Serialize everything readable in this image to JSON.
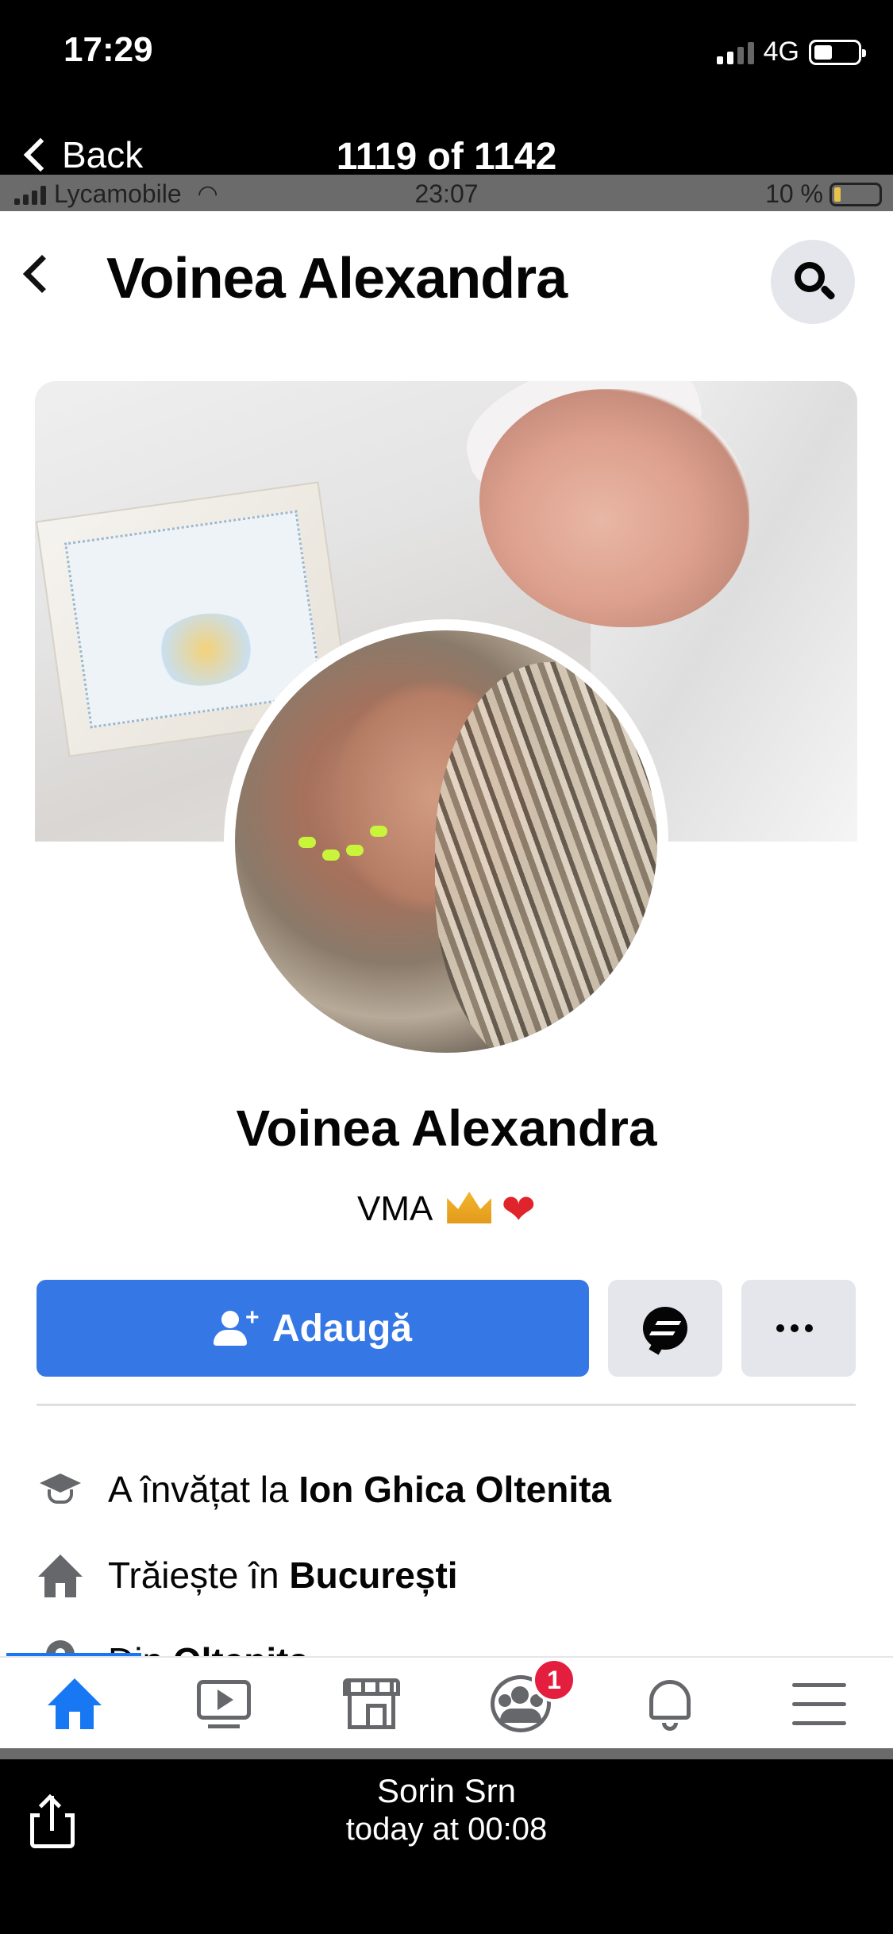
{
  "ios_status": {
    "time": "17:29",
    "network": "4G"
  },
  "viewer": {
    "back_label": "Back",
    "counter": "1119 of 1142"
  },
  "inner_status": {
    "carrier": "Lycamobile",
    "time": "23:07",
    "battery": "10 %"
  },
  "profile": {
    "header_title": "Voinea Alexandra",
    "name": "Voinea Alexandra",
    "bio": "VMA",
    "add_button_label": "Adaugă"
  },
  "info": {
    "education_prefix": "A învățat la",
    "education_value": "Ion Ghica Oltenita",
    "lives_prefix": "Trăiește în",
    "lives_value": "București",
    "from_prefix": "Din",
    "from_value": "Oltenița"
  },
  "tabbar": {
    "groups_badge": "1",
    "active": "home"
  },
  "message_footer": {
    "sender": "Sorin Srn",
    "timestamp": "today at 00:08"
  },
  "colors": {
    "accent": "#1877f2",
    "button": "#3578e5",
    "badge": "#e41e3f"
  }
}
